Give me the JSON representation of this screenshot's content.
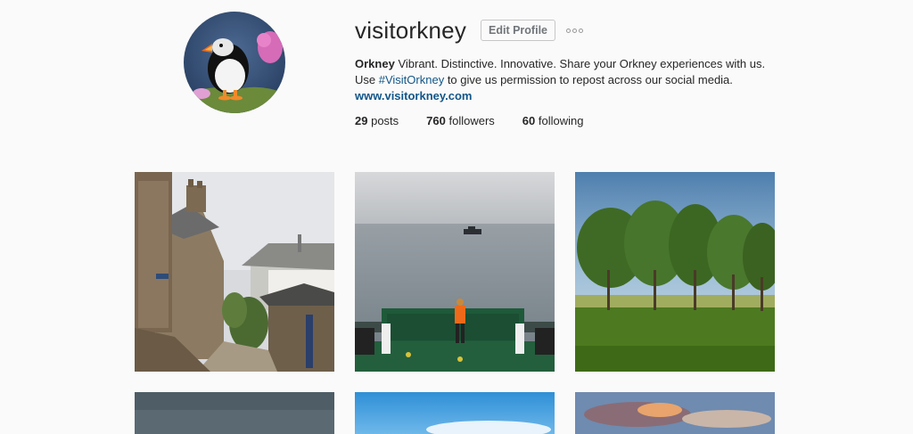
{
  "profile": {
    "username": "visitorkney",
    "edit_label": "Edit Profile",
    "more_icon": "more-options-icon",
    "avatar_icon": "puffin-avatar",
    "bio_name": "Orkney",
    "bio_line1": "Vibrant. Distinctive. Innovative. Share your Orkney experiences with us.",
    "bio_line2_prefix": "Use ",
    "bio_hashtag": "#VisitOrkney",
    "bio_line2_suffix": " to give us permission to repost across our social media.",
    "website": "www.visitorkney.com"
  },
  "stats": [
    {
      "count": "29",
      "label": "posts"
    },
    {
      "count": "760",
      "label": "followers"
    },
    {
      "count": "60",
      "label": "following"
    }
  ],
  "colors": {
    "background": "#fafafa",
    "text": "#262626",
    "link": "#125688",
    "button_border": "#c7c7c7"
  },
  "posts": [
    {
      "subject": "stone-village-lane"
    },
    {
      "subject": "ferry-deck-sea"
    },
    {
      "subject": "trees-field"
    },
    {
      "subject": "cloudy-sky"
    },
    {
      "subject": "blue-sky"
    },
    {
      "subject": "sunset-clouds"
    }
  ]
}
